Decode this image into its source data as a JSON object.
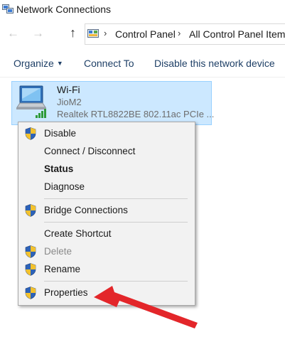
{
  "window": {
    "title": "Network Connections",
    "icon": "network-connections-icon"
  },
  "address_bar": {
    "back_icon": "arrow-left-icon",
    "forward_icon": "arrow-right-icon",
    "up_icon": "arrow-up-icon",
    "breadcrumbs": [
      "Control Panel",
      "All Control Panel Items"
    ]
  },
  "toolbar": {
    "organize": "Organize",
    "connect_to": "Connect To",
    "disable_device": "Disable this network device"
  },
  "connection": {
    "name": "Wi-Fi",
    "ssid": "JioM2",
    "adapter": "Realtek RTL8822BE 802.11ac PCIe ..."
  },
  "context_menu": {
    "items": [
      {
        "label": "Disable",
        "shield": true
      },
      {
        "label": "Connect / Disconnect",
        "shield": false
      },
      {
        "label": "Status",
        "shield": false,
        "bold": true
      },
      {
        "label": "Diagnose",
        "shield": false
      },
      {
        "label": "Bridge Connections",
        "shield": true
      },
      {
        "label": "Create Shortcut",
        "shield": false
      },
      {
        "label": "Delete",
        "shield": true,
        "disabled": true
      },
      {
        "label": "Rename",
        "shield": true
      },
      {
        "label": "Properties",
        "shield": true
      }
    ]
  },
  "colors": {
    "selection_bg": "#cce8ff",
    "selection_border": "#99d1ff",
    "menu_bg": "#f2f2f2",
    "arrow": "#e3262a",
    "toolbar_text": "#1e3f66"
  }
}
